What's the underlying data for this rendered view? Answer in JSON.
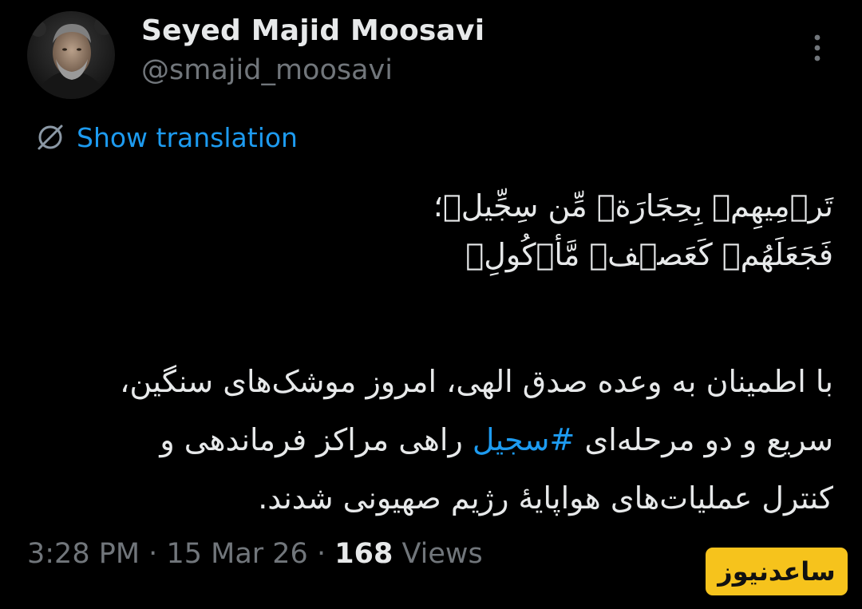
{
  "author": {
    "display_name": "Seyed Majid Moosavi",
    "handle": "@smajid_moosavi"
  },
  "actions": {
    "more_icon": "more-vertical-icon",
    "translate_icon": "translate-icon",
    "show_translation": "Show translation"
  },
  "tweet": {
    "verse_line_1": "تَرۡمِيهِمۡ بِحِجَارَةٖ مِّن سِجِّيلٖ؛",
    "verse_line_2": "فَجَعَلَهُمۡ كَعَصۡفٖ مَّأۡكُولِۭ",
    "body_line_1": "با اطمینان به وعده صدق الهی، امروز موشک‌های سنگین،",
    "body_line_2_before": "سریع و دو مرحله‌ای ",
    "hashtag": "#سجیل",
    "body_line_2_after": " راهی مراکز فرماندهی و",
    "body_line_3": "کنترل عملیات‌های هواپایهٔ رژیم صهیونی شدند."
  },
  "meta": {
    "time": "3:28 PM",
    "separator": "·",
    "date": "15 Mar 26",
    "views_count": "168",
    "views_label": "Views"
  },
  "watermark": {
    "text": "ساعدنیوز"
  },
  "colors": {
    "background": "#000000",
    "text": "#e7e9ea",
    "muted": "#71767b",
    "link": "#1d9bf0",
    "watermark_bg": "#f6c31c"
  }
}
